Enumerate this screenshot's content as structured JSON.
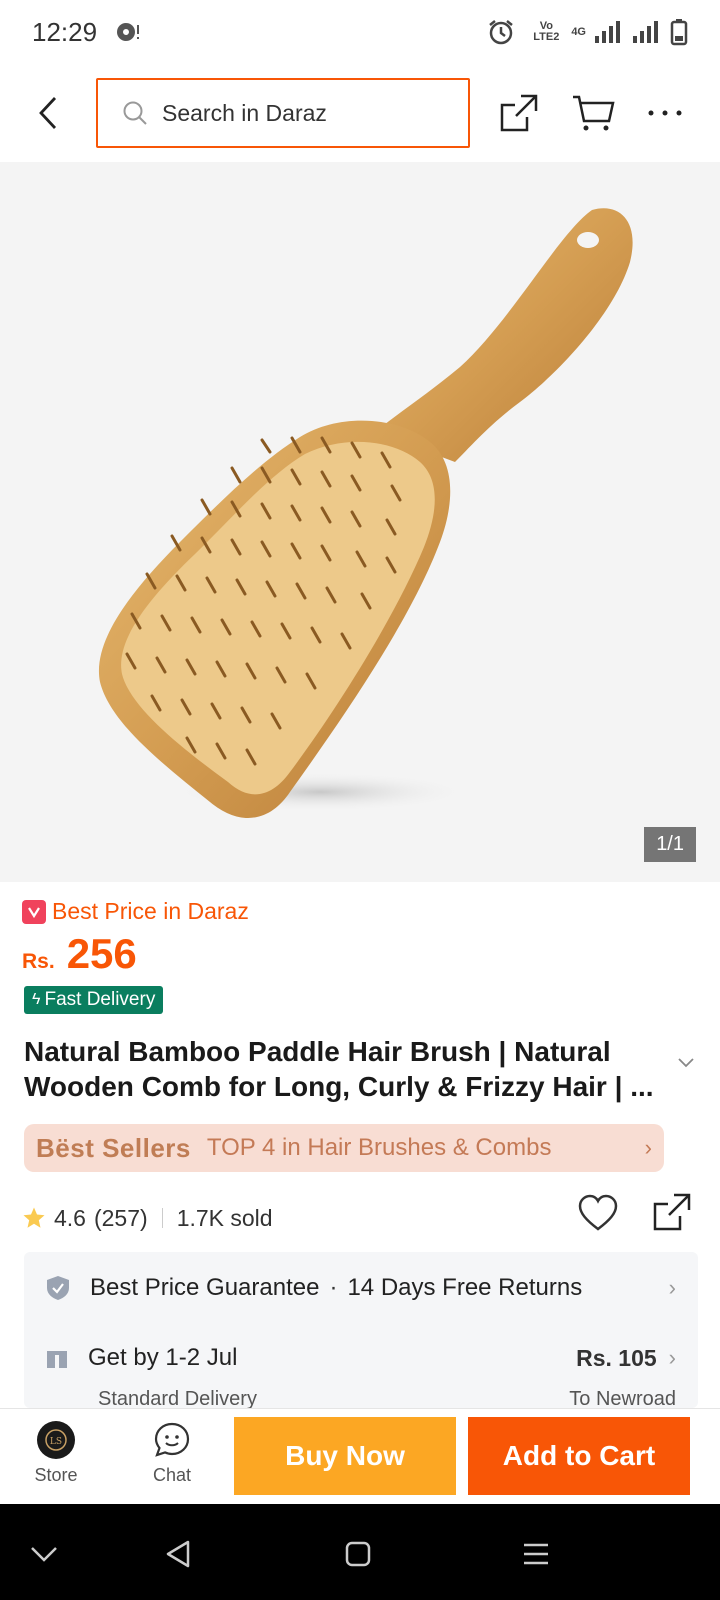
{
  "status_bar": {
    "time": "12:29",
    "network_label": "Vo LTE2",
    "network_gen": "4G"
  },
  "header": {
    "search_placeholder": "Search in Daraz"
  },
  "product_image": {
    "counter": "1/1"
  },
  "product": {
    "best_price_label": "Best Price in Daraz",
    "currency": "Rs.",
    "price": "256",
    "fast_delivery": "Fast Delivery",
    "title": "Natural Bamboo Paddle Hair Brush | Natural Wooden Comb for Long, Curly & Frizzy Hair | ...",
    "bestsellers_brand": "Bëst Sellers",
    "bestsellers_rank": "TOP 4 in Hair Brushes & Combs",
    "rating": "4.6",
    "rating_count": "(257)",
    "sold": "1.7K sold"
  },
  "services": {
    "guarantee": "Best Price Guarantee",
    "returns": "14 Days Free Returns",
    "delivery_date": "Get by 1-2 Jul",
    "delivery_price": "Rs. 105",
    "delivery_type": "Standard Delivery",
    "delivery_location": "To Newroad"
  },
  "bottom_bar": {
    "store_label": "Store",
    "chat_label": "Chat",
    "buy_now": "Buy Now",
    "add_to_cart": "Add to Cart"
  },
  "colors": {
    "accent": "#f85606",
    "buy_now": "#fca723",
    "fast_delivery": "#0a7e5f",
    "bestsellers_bg": "#f8ddd3"
  }
}
